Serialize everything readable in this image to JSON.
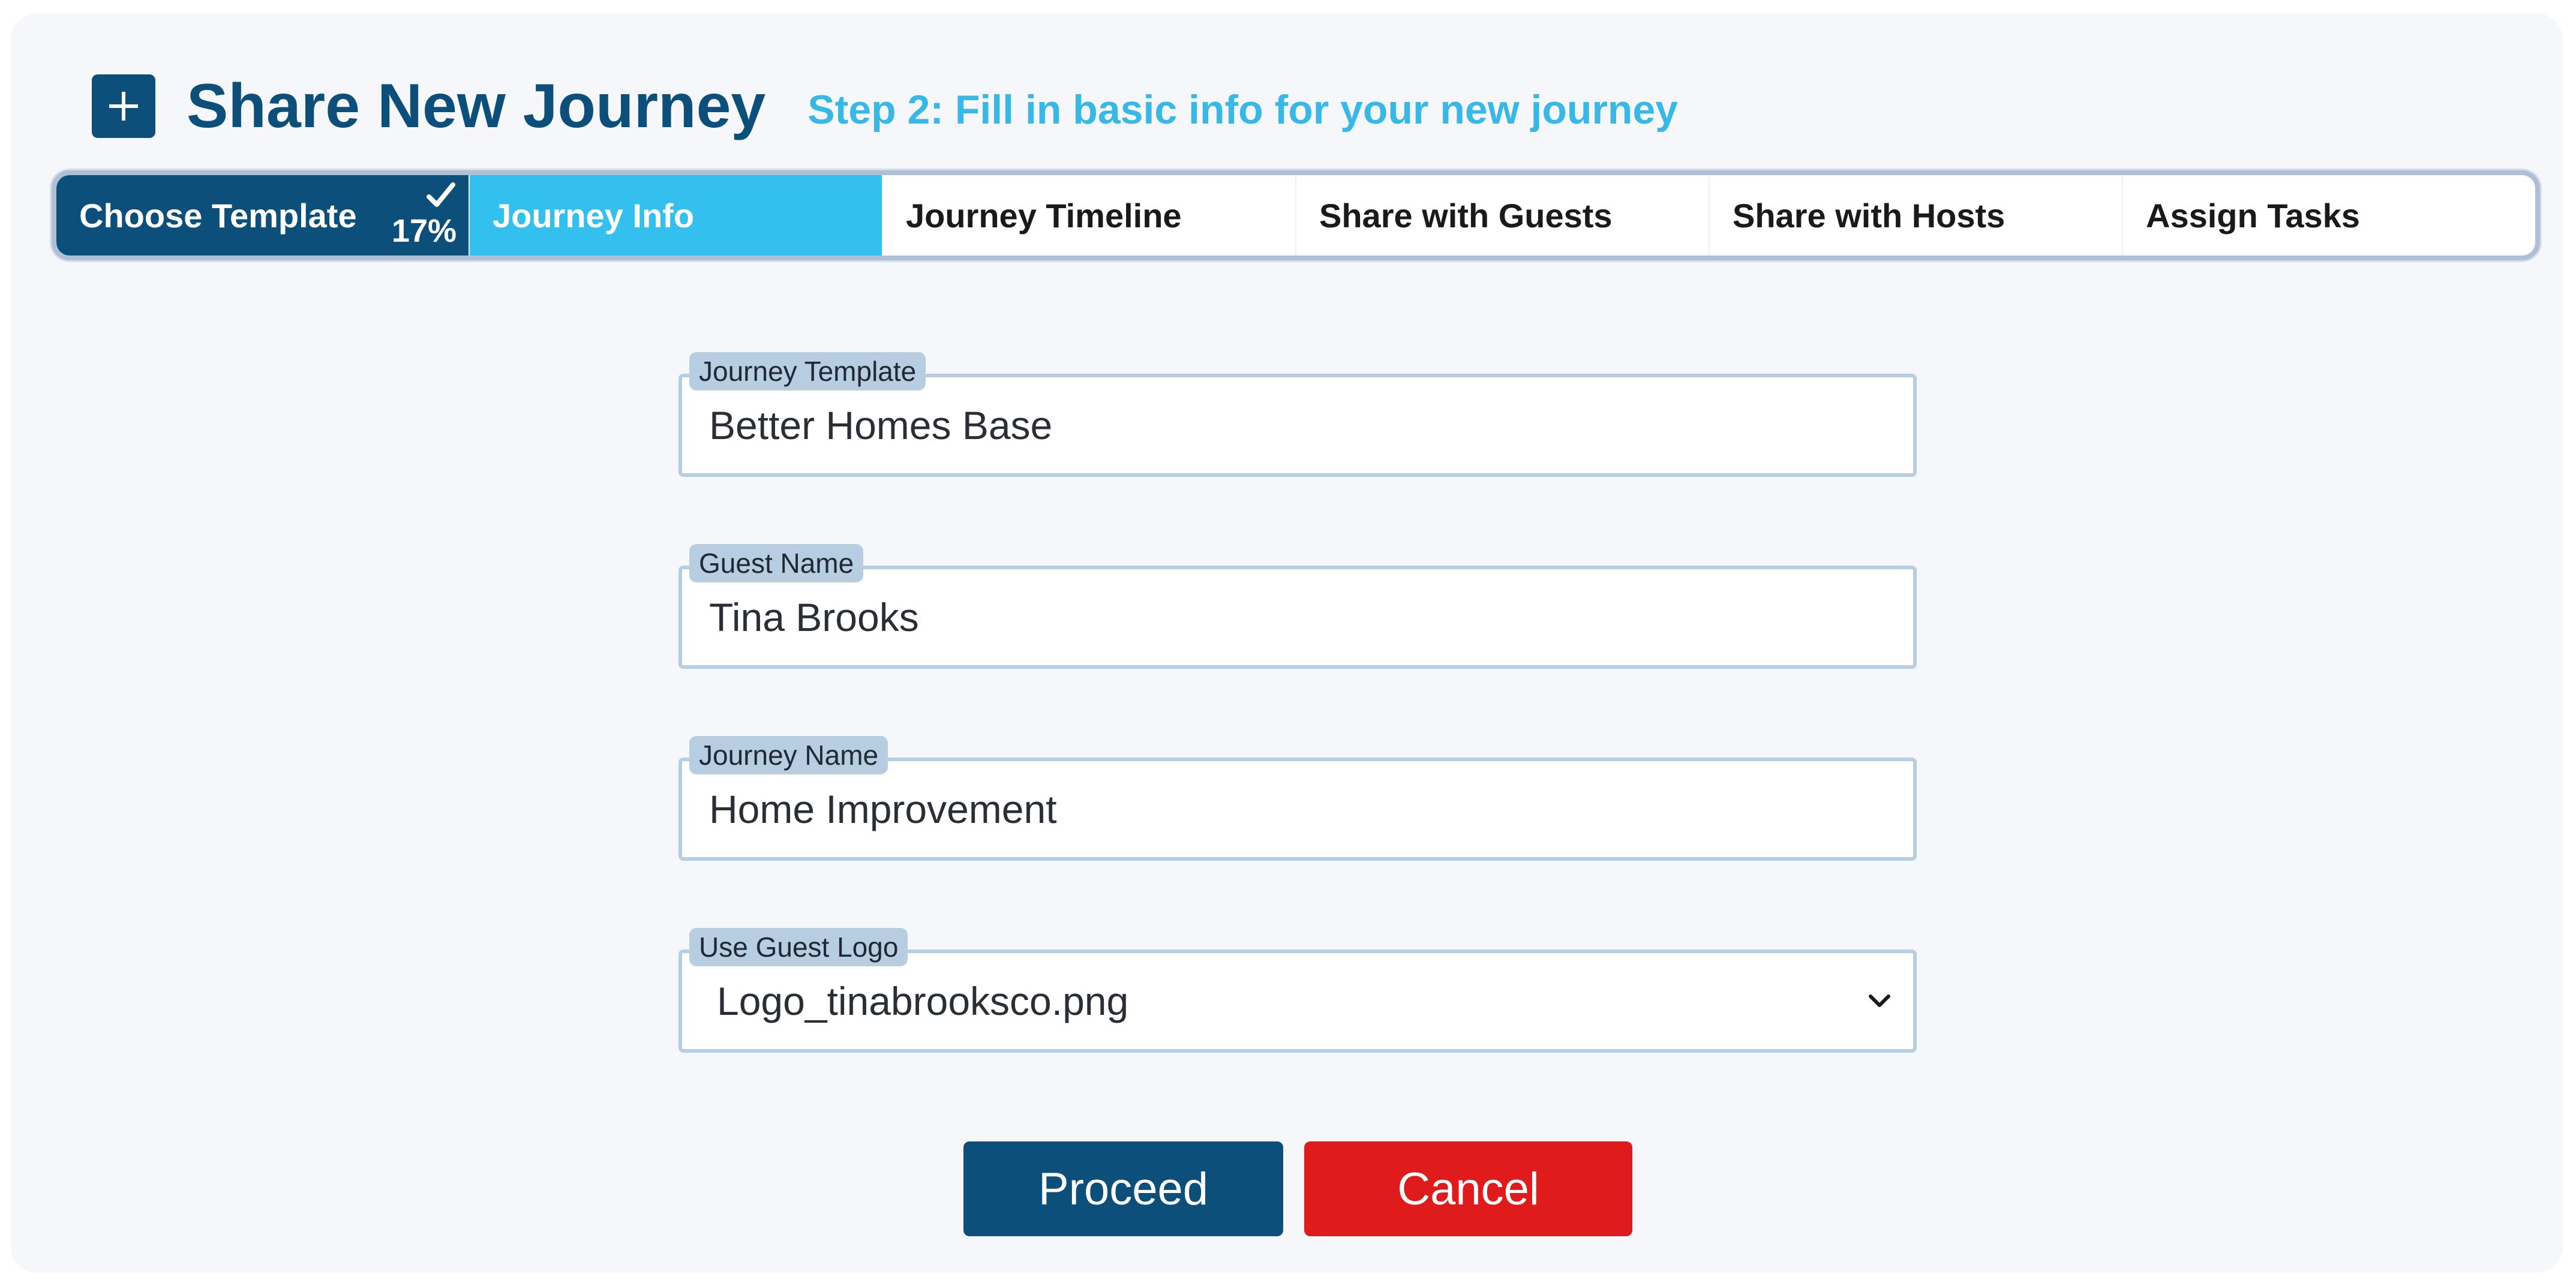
{
  "header": {
    "title": "Share New Journey",
    "subtitle": "Step 2: Fill in basic info for your new journey"
  },
  "stepper": {
    "progress": "17%",
    "steps": [
      {
        "label": "Choose Template",
        "state": "done"
      },
      {
        "label": "Journey Info",
        "state": "active"
      },
      {
        "label": "Journey Timeline",
        "state": "pending"
      },
      {
        "label": "Share with Guests",
        "state": "pending"
      },
      {
        "label": "Share with Hosts",
        "state": "pending"
      },
      {
        "label": "Assign Tasks",
        "state": "pending"
      }
    ]
  },
  "form": {
    "journey_template": {
      "label": "Journey Template",
      "value": "Better Homes Base"
    },
    "guest_name": {
      "label": "Guest Name",
      "value": "Tina Brooks"
    },
    "journey_name": {
      "label": "Journey Name",
      "value": "Home Improvement"
    },
    "guest_logo": {
      "label": "Use Guest Logo",
      "value": "Logo_tinabrooksco.png"
    }
  },
  "actions": {
    "proceed_label": "Proceed",
    "cancel_label": "Cancel"
  },
  "icons": {
    "add": "plus-icon",
    "complete": "check-icon",
    "dropdown": "chevron-down-icon"
  },
  "colors": {
    "brand": "#0b4f7a",
    "accent": "#33c0ee",
    "danger": "#e01b1b",
    "field_border": "#b7cde1"
  }
}
